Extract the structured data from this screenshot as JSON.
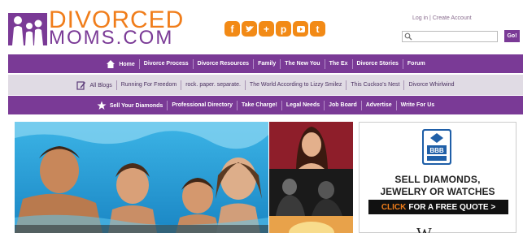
{
  "header": {
    "logo_line1": "DIVORCED",
    "logo_line2": "MOMS.COM",
    "social_icons": [
      {
        "name": "facebook-icon",
        "glyph": "f"
      },
      {
        "name": "twitter-icon",
        "glyph": "t"
      },
      {
        "name": "google-plus-icon",
        "glyph": "+"
      },
      {
        "name": "pinterest-icon",
        "glyph": "p"
      },
      {
        "name": "youtube-icon",
        "glyph": "▶"
      },
      {
        "name": "tumblr-icon",
        "glyph": "t"
      }
    ],
    "login_label": "Log in",
    "separator": "|",
    "create_account_label": "Create Account",
    "search_placeholder": "",
    "go_label": "Go!"
  },
  "nav_main": {
    "items": [
      "Home",
      "Divorce Process",
      "Divorce Resources",
      "Family",
      "The New You",
      "The Ex",
      "Divorce Stories",
      "Forum"
    ]
  },
  "nav_blogs": {
    "items": [
      "All Blogs",
      "Running For Freedom",
      "rock. paper. separate.",
      "The World According to Lizzy Smilez",
      "This Cuckoo's Nest",
      "Divorce Whirlwind"
    ]
  },
  "nav_services": {
    "items": [
      "Sell Your Diamonds",
      "Professional Directory",
      "Take Charge!",
      "Legal Needs",
      "Job Board",
      "Advertise",
      "Write For Us"
    ]
  },
  "ad": {
    "line1": "SELL DIAMONDS,",
    "line2": "JEWELRY OR WATCHES",
    "cta_click": "CLICK",
    "cta_rest": "FOR A FREE QUOTE >",
    "logo_partial": "W"
  },
  "colors": {
    "brand_purple": "#7a3a96",
    "brand_orange": "#f07d1a",
    "blog_bar": "#e0dbe4"
  }
}
